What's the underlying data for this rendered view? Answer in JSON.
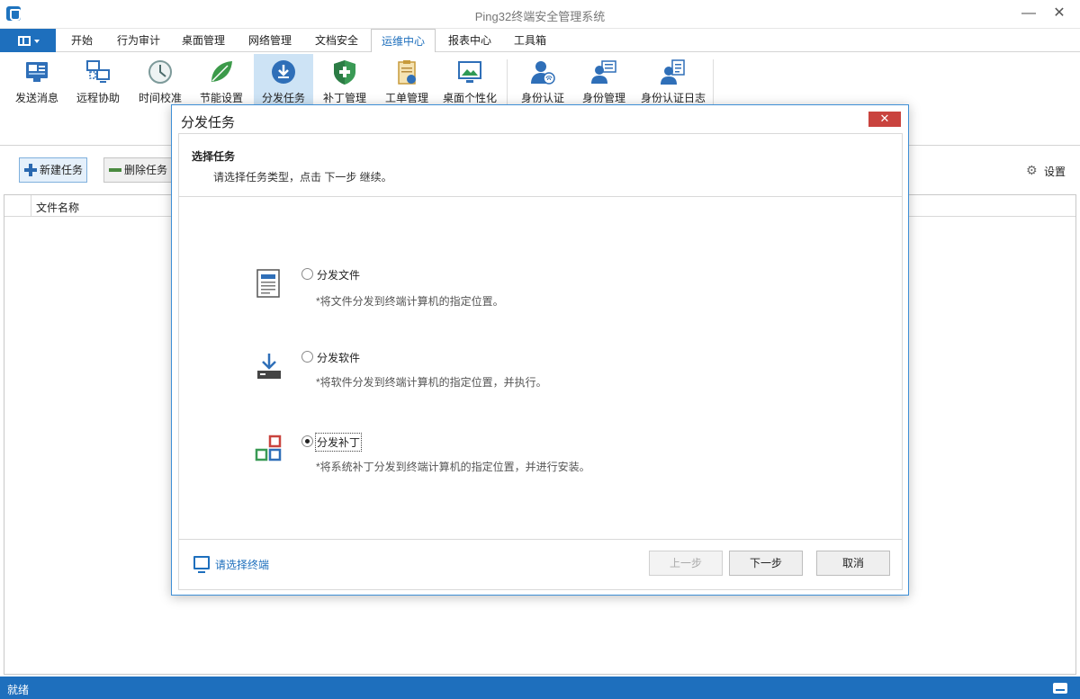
{
  "window": {
    "title": "Ping32终端安全管理系统",
    "minimize": "—",
    "close": "✕"
  },
  "menu": {
    "tabs": [
      "开始",
      "行为审计",
      "桌面管理",
      "网络管理",
      "文档安全",
      "运维中心",
      "报表中心",
      "工具箱"
    ],
    "active": "运维中心"
  },
  "ribbon": {
    "buttons": [
      {
        "label": "发送消息",
        "icon": "send-message-icon"
      },
      {
        "label": "远程协助",
        "icon": "remote-assist-icon"
      },
      {
        "label": "时间校准",
        "icon": "clock-icon"
      },
      {
        "label": "节能设置",
        "icon": "leaf-icon"
      },
      {
        "label": "分发任务",
        "icon": "download-circle-icon"
      },
      {
        "label": "补丁管理",
        "icon": "shield-icon"
      },
      {
        "label": "工单管理",
        "icon": "clipboard-icon"
      },
      {
        "label": "桌面个性化",
        "icon": "monitor-icon"
      },
      {
        "label": "身份认证",
        "icon": "user-fingerprint-icon"
      },
      {
        "label": "身份管理",
        "icon": "user-card-icon"
      },
      {
        "label": "身份认证日志",
        "icon": "user-log-icon"
      }
    ],
    "active": "分发任务"
  },
  "toolbar": {
    "new_task": "新建任务",
    "delete_task": "删除任务",
    "settings": "设置"
  },
  "table": {
    "columns": [
      "文件名称"
    ]
  },
  "status": {
    "text": "就绪"
  },
  "dialog": {
    "title": "分发任务",
    "close": "✕",
    "header_title": "选择任务",
    "header_subtitle": "请选择任务类型，点击 下一步 继续。",
    "options": [
      {
        "label": "分发文件",
        "desc": "*将文件分发到终端计算机的指定位置。",
        "checked": false
      },
      {
        "label": "分发软件",
        "desc": "*将软件分发到终端计算机的指定位置，并执行。",
        "checked": false
      },
      {
        "label": "分发补丁",
        "desc": "*将系统补丁分发到终端计算机的指定位置，并进行安装。",
        "checked": true
      }
    ],
    "pick_terminal": "请选择终端",
    "buttons": {
      "prev": "上一步",
      "next": "下一步",
      "cancel": "取消"
    },
    "prev_disabled": true
  }
}
